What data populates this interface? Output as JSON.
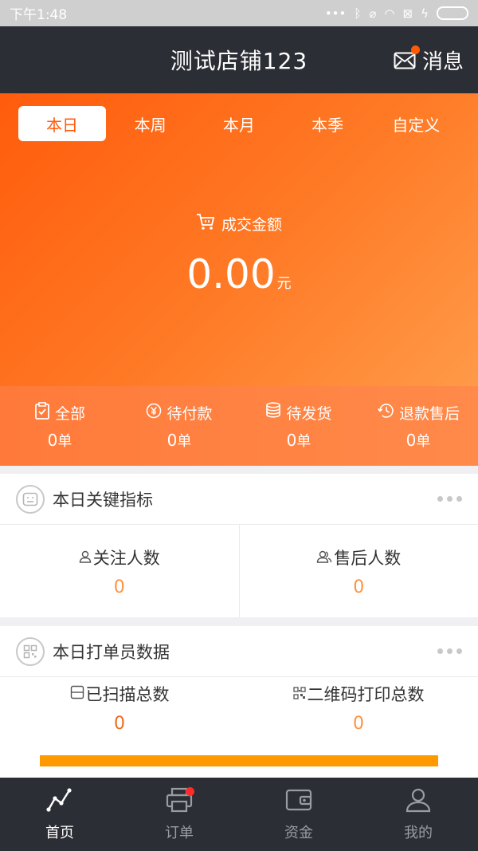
{
  "status_bar": {
    "time": "下午1:48"
  },
  "header": {
    "title": "测试店铺123",
    "message_label": "消息"
  },
  "period_tabs": [
    {
      "label": "本日",
      "active": true
    },
    {
      "label": "本周",
      "active": false
    },
    {
      "label": "本月",
      "active": false
    },
    {
      "label": "本季",
      "active": false
    },
    {
      "label": "自定义",
      "active": false
    }
  ],
  "hero": {
    "label": "成交金额",
    "value": "0.00",
    "unit": "元"
  },
  "order_stats": [
    {
      "label": "全部",
      "count": "0",
      "unit": "单",
      "icon": "clipboard-icon"
    },
    {
      "label": "待付款",
      "count": "0",
      "unit": "单",
      "icon": "yen-icon"
    },
    {
      "label": "待发货",
      "count": "0",
      "unit": "单",
      "icon": "coins-icon"
    },
    {
      "label": "退款售后",
      "count": "0",
      "unit": "单",
      "icon": "history-icon"
    }
  ],
  "key_metrics": {
    "title": "本日关键指标",
    "items": [
      {
        "label": "关注人数",
        "value": "0"
      },
      {
        "label": "售后人数",
        "value": "0"
      }
    ]
  },
  "printer_data": {
    "title": "本日打单员数据",
    "items": [
      {
        "label": "已扫描总数",
        "value": "0"
      },
      {
        "label": "二维码打印总数",
        "value": "0"
      }
    ],
    "progress_fraction": 1.0
  },
  "tabbar": [
    {
      "label": "首页",
      "active": true
    },
    {
      "label": "订单",
      "active": false
    },
    {
      "label": "资金",
      "active": false
    },
    {
      "label": "我的",
      "active": false
    }
  ],
  "colors": {
    "accent": "#ff5a0a",
    "header_bg": "#2c2e35",
    "progress": "#ff9900"
  }
}
